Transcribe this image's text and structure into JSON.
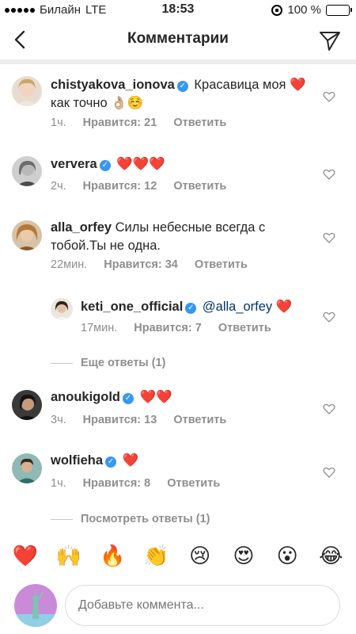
{
  "status_bar": {
    "carrier": "Билайн",
    "network": "LTE",
    "time": "18:53",
    "battery": "100 %"
  },
  "header": {
    "title": "Комментарии"
  },
  "comments": [
    {
      "username": "chistyakova_ionova",
      "verified": true,
      "text": "Красавица моя ❤️ как точно 👌🏼☺️",
      "time": "1ч.",
      "likes": "Нравится: 21",
      "reply": "Ответить"
    },
    {
      "username": "ververa",
      "verified": true,
      "text": "❤️❤️❤️",
      "time": "2ч.",
      "likes": "Нравится: 12",
      "reply": "Ответить"
    },
    {
      "username": "alla_orfey",
      "verified": false,
      "text": "Силы небесные всегда с тобой.Ты не одна.",
      "time": "22мин.",
      "likes": "Нравится: 34",
      "reply": "Ответить"
    },
    {
      "username": "keti_one_official",
      "verified": true,
      "mention": "@alla_orfey",
      "text": "❤️",
      "time": "17мин.",
      "likes": "Нравится: 7",
      "reply": "Ответить"
    },
    {
      "username": "anoukigold",
      "verified": true,
      "text": "❤️❤️",
      "time": "3ч.",
      "likes": "Нравится: 13",
      "reply": "Ответить"
    },
    {
      "username": "wolfieha",
      "verified": true,
      "text": "❤️",
      "time": "1ч.",
      "likes": "Нравится: 8",
      "reply": "Ответить"
    }
  ],
  "more_replies": "Еще ответы (1)",
  "view_replies": "Посмотреть ответы (1)",
  "emoji_bar": [
    "❤️",
    "🙌",
    "🔥",
    "👏",
    "😢",
    "😍",
    "😮",
    "😂"
  ],
  "composer": {
    "placeholder": "Добавьте коммента..."
  },
  "colors": {
    "verified": "#3897f0",
    "meta_text": "#8e8e8e",
    "mention": "#003569"
  }
}
